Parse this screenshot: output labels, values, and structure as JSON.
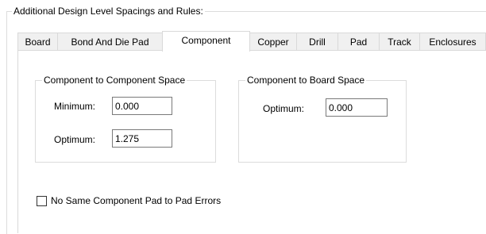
{
  "section": {
    "title": "Additional Design Level Spacings and Rules:"
  },
  "tabs": [
    {
      "label": "Board",
      "active": false
    },
    {
      "label": "Bond And Die Pad",
      "active": false
    },
    {
      "label": "Component",
      "active": true
    },
    {
      "label": "Copper",
      "active": false
    },
    {
      "label": "Drill",
      "active": false
    },
    {
      "label": "Pad",
      "active": false
    },
    {
      "label": "Track",
      "active": false
    },
    {
      "label": "Enclosures",
      "active": false
    }
  ],
  "component_to_component": {
    "title": "Component to Component Space",
    "minimum_label": "Minimum:",
    "minimum_value": "0.000",
    "optimum_label": "Optimum:",
    "optimum_value": "1.275"
  },
  "component_to_board": {
    "title": "Component to Board Space",
    "optimum_label": "Optimum:",
    "optimum_value": "0.000"
  },
  "no_same_component_pad": {
    "label": "No Same Component Pad to Pad Errors",
    "checked": false
  }
}
